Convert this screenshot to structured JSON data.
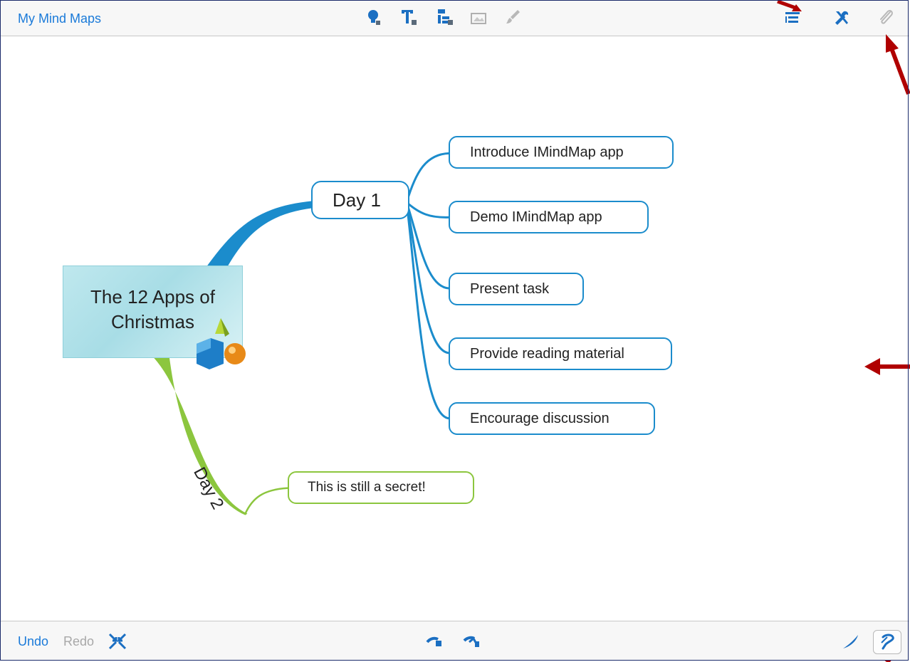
{
  "header": {
    "back_link": "My Mind Maps",
    "icons": [
      "lightbulb-icon",
      "text-icon",
      "branch-structure-icon",
      "image-icon",
      "paintbrush-icon",
      "outline-list-icon",
      "tools-icon",
      "paperclip-icon"
    ]
  },
  "footer": {
    "undo": "Undo",
    "redo": "Redo",
    "icons": [
      "collapse-icon",
      "branch-left-icon",
      "branch-right-icon",
      "pen-icon",
      "eraser-icon"
    ]
  },
  "map": {
    "central": "The 12 Apps of Christmas",
    "day1": {
      "label": "Day 1",
      "children": [
        "Introduce IMindMap app",
        "Demo IMindMap app",
        "Present task",
        "Provide reading material",
        "Encourage discussion"
      ]
    },
    "day2": {
      "label": "Day 2",
      "children": [
        "This is still a secret!"
      ]
    }
  },
  "colors": {
    "accent": "#1a7ad9",
    "branch_blue": "#1b8ccc",
    "branch_green": "#8cc63e",
    "annotation_arrow": "#b00000"
  }
}
